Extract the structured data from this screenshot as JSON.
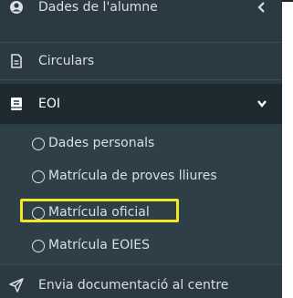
{
  "sidebar": {
    "items": [
      {
        "label": "Dades de l'alumne",
        "icon": "user-circle-icon"
      },
      {
        "label": "Circulars",
        "icon": "document-icon"
      },
      {
        "label": "EOI",
        "icon": "book-icon"
      },
      {
        "label": "Envia documentació al centre",
        "icon": "send-icon"
      }
    ],
    "eoi_submenu": [
      {
        "label": "Dades personals"
      },
      {
        "label": "Matrícula de proves lliures"
      },
      {
        "label": "Matrícula oficial"
      },
      {
        "label": "Matrícula EOIES"
      }
    ]
  },
  "colors": {
    "sidebar_bg": "#2b3a42",
    "active_bg": "#1e2a30",
    "text": "#d9dfe3",
    "highlight": "#f2e52a"
  }
}
